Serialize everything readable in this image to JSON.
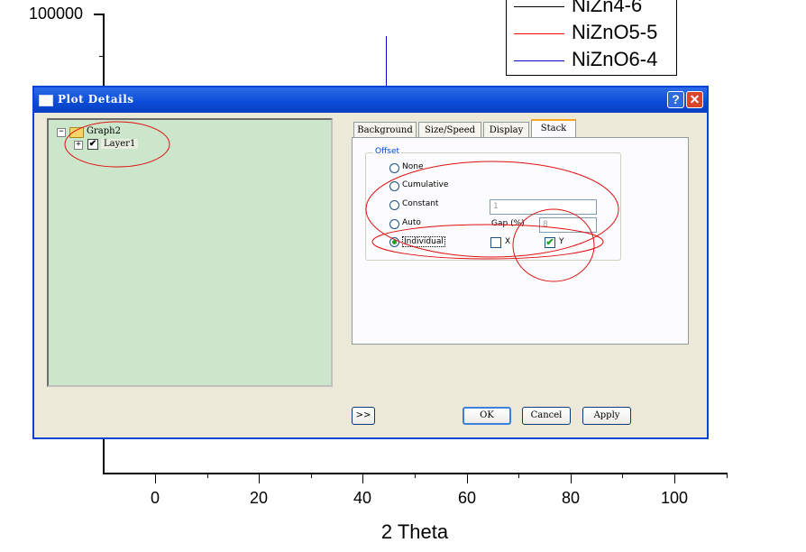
{
  "plot": {
    "y_top_label": "100000",
    "x_ticks": [
      "0",
      "20",
      "40",
      "60",
      "80",
      "100"
    ],
    "x_title": "2 Theta",
    "legend": [
      {
        "label": "NiZn4-6",
        "color": "#000000"
      },
      {
        "label": "NiZnO5-5",
        "color": "#ff0000"
      },
      {
        "label": "NiZnO6-4",
        "color": "#0000cc"
      }
    ]
  },
  "dialog": {
    "title": "Plot Details",
    "help_glyph": "?",
    "close_glyph": "✕",
    "tree": {
      "root_label": "Graph2",
      "root_expander": "−",
      "child_label": "Layer1",
      "child_expander": "+",
      "child_checked": "✔"
    },
    "tabs": [
      "Background",
      "Size/Speed",
      "Display",
      "Stack"
    ],
    "active_tab": "Stack",
    "stack": {
      "group_title": "Offset",
      "options": [
        "None",
        "Cumulative",
        "Constant",
        "Auto",
        "Individual"
      ],
      "selected_option": "Individual",
      "constant_value": "1",
      "gap_label": "Gap (%)",
      "gap_value": "8",
      "x_label": "X",
      "y_label": "Y",
      "x_checked": false,
      "y_checked": "✔"
    },
    "buttons": {
      "expand": ">>",
      "ok": "OK",
      "cancel": "Cancel",
      "apply": "Apply"
    }
  },
  "colors": {
    "annotation": "#e01010",
    "titlebar": "#0a4bd6",
    "tree_bg": "#cce6cc",
    "dialog_bg": "#ece9d8"
  }
}
